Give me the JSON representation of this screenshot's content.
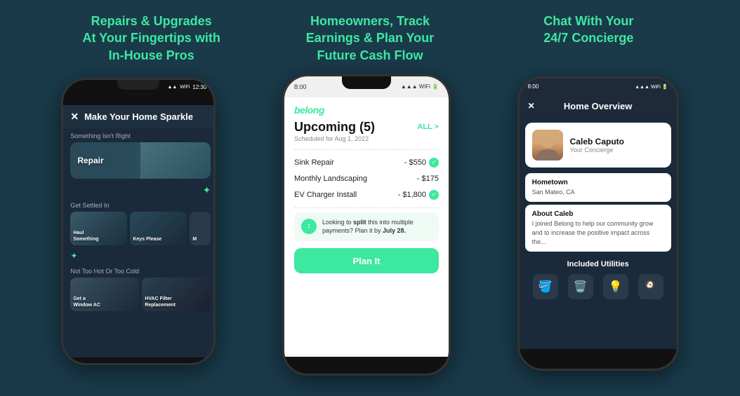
{
  "header": {
    "tagline1": "Repairs & Upgrades\nAt Your Fingertips with\nIn-House Pros",
    "tagline2": "Homeowners, Track\nEarnings & Plan Your\nFuture Cash Flow",
    "tagline3": "Chat With Your\n24/7 Concierge"
  },
  "phone1": {
    "status": {
      "time": "12:30",
      "signal": "▲▲▲",
      "wifi": "WiFi",
      "battery": "⬜"
    },
    "title": "Make Your Home Sparkle",
    "section1": "Something Isn't Right",
    "repair_label": "Repair",
    "section2": "Get Settled In",
    "haul_label": "Haul\nSomething",
    "keys_label": "Keys Please",
    "section3": "Not Too Hot Or Too Cold",
    "ac_label": "Get a\nWindow AC",
    "hvac_label": "HVAC Filter\nReplacement"
  },
  "phone2": {
    "status": {
      "time": "8:00",
      "signal": "▲▲▲",
      "wifi": "WiFi",
      "battery": "⬜"
    },
    "logo": "belong",
    "upcoming_title": "Upcoming (5)",
    "all_label": "ALL >",
    "scheduled": "Scheduled for Aug 1, 2022",
    "items": [
      {
        "label": "Sink Repair",
        "amount": "- $550",
        "checked": true
      },
      {
        "label": "Monthly Landscaping",
        "amount": "- $175",
        "checked": false
      },
      {
        "label": "EV Charger Install",
        "amount": "- $1,800",
        "checked": true
      }
    ],
    "split_text": "Looking to split this into multiple payments? Plan it by July 28.",
    "plan_button": "Plan It"
  },
  "phone3": {
    "status": {
      "time": "8:00",
      "signal": "▲▲▲",
      "wifi": "WiFi",
      "battery": "⬜"
    },
    "title": "Home Overview",
    "concierge_name": "Caleb Caputo",
    "concierge_role": "Your Concierge",
    "hometown_label": "Hometown",
    "hometown_value": "San Mateo, CA",
    "about_label": "About Caleb",
    "about_text": "I joined Belong to help our community grow and to increase the positive impact across the...",
    "utilities_title": "Included Utilities",
    "utility_icons": [
      "🪣",
      "🗑️",
      "💡",
      "🍳"
    ]
  }
}
